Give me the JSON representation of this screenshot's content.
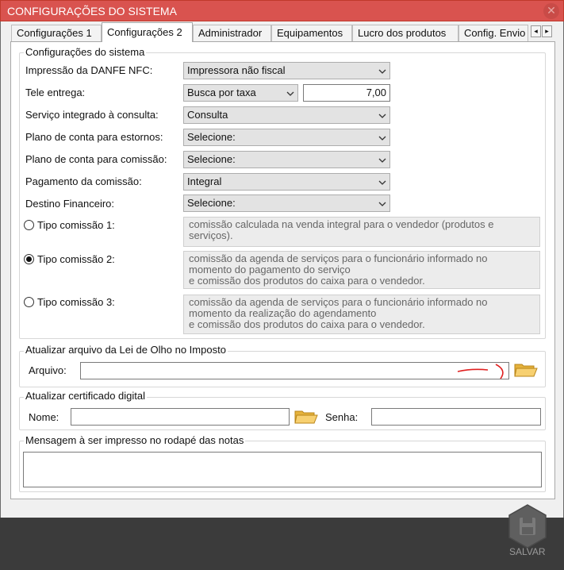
{
  "window": {
    "title": "CONFIGURAÇÕES DO SISTEMA"
  },
  "tabs": [
    {
      "label": "Configurações 1",
      "active": false
    },
    {
      "label": "Configurações 2",
      "active": true
    },
    {
      "label": "Administrador",
      "active": false
    },
    {
      "label": "Equipamentos",
      "active": false
    },
    {
      "label": "Lucro dos produtos",
      "active": false
    },
    {
      "label": "Config. Envio",
      "active": false
    }
  ],
  "system_group": {
    "legend": "Configurações do sistema",
    "fields": [
      {
        "label": "Impressão da DANFE NFC:",
        "value": "Impressora não fiscal"
      },
      {
        "label": "Tele entrega:",
        "value": "Busca por taxa",
        "amount": "7,00"
      },
      {
        "label": "Serviço integrado à consulta:",
        "value": "Consulta"
      },
      {
        "label": "Plano de conta para estornos:",
        "value": "Selecione:"
      },
      {
        "label": "Plano de conta para comissão:",
        "value": "Selecione:"
      },
      {
        "label": "Pagamento da comissão:",
        "value": "Integral"
      },
      {
        "label": "Destino Financeiro:",
        "value": "Selecione:"
      }
    ],
    "commission_types": [
      {
        "label": "Tipo comissão 1:",
        "selected": false,
        "description": "comissão calculada na venda integral para o vendedor (produtos e\nserviços)."
      },
      {
        "label": "Tipo comissão 2:",
        "selected": true,
        "description": "comissão da agenda de serviços para o funcionário informado no\nmomento do pagamento do serviço\n e comissão dos produtos do caixa para o vendedor."
      },
      {
        "label": "Tipo comissão 3:",
        "selected": false,
        "description": "comissão da agenda de serviços para o funcionário informado no\nmomento da realização do agendamento\ne comissão dos produtos do caixa para o vendedor."
      }
    ]
  },
  "olho_group": {
    "legend": "Atualizar arquivo da Lei de Olho no Imposto",
    "file_label": "Arquivo:",
    "file_value": ""
  },
  "cert_group": {
    "legend": "Atualizar certificado digital",
    "name_label": "Nome:",
    "name_value": "",
    "password_label": "Senha:",
    "password_value": ""
  },
  "footer_group": {
    "legend": "Mensagem à ser impresso no rodapé das notas",
    "message_value": ""
  },
  "save": {
    "label": "SALVAR"
  },
  "colors": {
    "titlebar": "#d9534f",
    "bottombar": "#3b3b3b",
    "annotation": "#e02020"
  }
}
